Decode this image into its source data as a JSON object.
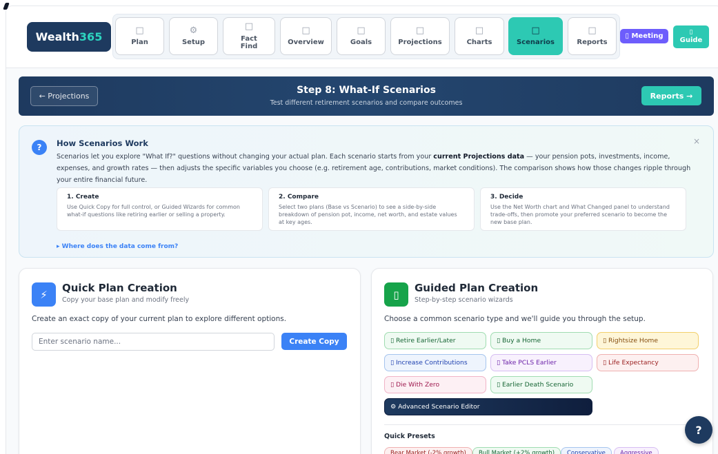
{
  "brand": {
    "name": "Wealth",
    "num": "365"
  },
  "nav": [
    {
      "icon": "□",
      "label": "Plan"
    },
    {
      "icon": "⚙",
      "label": "Setup"
    },
    {
      "icon": "□",
      "label": "Fact\nFind"
    },
    {
      "icon": "□",
      "label": "Overview"
    },
    {
      "icon": "□",
      "label": "Goals"
    },
    {
      "icon": "□",
      "label": "Projections"
    },
    {
      "icon": "□",
      "label": "Charts"
    },
    {
      "icon": "□",
      "label": "Scenarios"
    },
    {
      "icon": "□",
      "label": "Reports"
    }
  ],
  "header_actions": {
    "meeting": "▯ Meeting",
    "guide_icon": "▯",
    "guide": "Guide"
  },
  "step": {
    "back_label": "← Projections",
    "title": "Step 8: What-If Scenarios",
    "subtitle": "Test different retirement scenarios and compare outcomes",
    "next_label": "Reports →"
  },
  "info": {
    "icon": "?",
    "close": "×",
    "title": "How Scenarios Work",
    "text_pre": "Scenarios let you explore \"What If?\" questions without changing your actual plan. Each scenario starts from your ",
    "text_bold": "current Projections data",
    "text_post": " — your pension pots, investments, income, expenses, and growth rates — then adjusts the specific variables you choose (e.g. retirement age, contributions, market conditions). The comparison shows how those changes ripple through your entire financial future.",
    "cards": [
      {
        "title": "1. Create",
        "desc": "Use Quick Copy for full control, or Guided Wizards for common what-if questions like retiring earlier or selling a property."
      },
      {
        "title": "2. Compare",
        "desc": "Select two plans (Base vs Scenario) to see a side-by-side breakdown of pension pot, income, net worth, and estate values at key ages."
      },
      {
        "title": "3. Decide",
        "desc": "Use the Net Worth chart and What Changed panel to understand trade-offs, then promote your preferred scenario to become the new base plan."
      }
    ],
    "data_link": "▸ Where does the data come from?"
  },
  "quick": {
    "icon": "⚡",
    "title": "Quick Plan Creation",
    "subtitle": "Copy your base plan and modify freely",
    "desc": "Create an exact copy of your current plan to explore different options.",
    "input_placeholder": "Enter scenario name...",
    "input_value": "",
    "button": "Create Copy"
  },
  "guided": {
    "icon": "▯",
    "title": "Guided Plan Creation",
    "subtitle": "Step-by-step scenario wizards",
    "desc": "Choose a common scenario type and we'll guide you through the setup.",
    "chips": [
      "▯ Retire Earlier/Later",
      "▯ Buy a Home",
      "▯ Rightsize Home",
      "▯ Increase Contributions",
      "▯ Take PCLS Earlier",
      "▯ Life Expectancy",
      "▯ Die With Zero",
      "▯ Earlier Death Scenario",
      "⚙ Advanced Scenario Editor"
    ],
    "presets_title": "Quick Presets",
    "presets": [
      "Bear Market (-2% growth)",
      "Bull Market (+2% growth)",
      "Conservative",
      "Aggressive"
    ]
  },
  "help_fab": "?",
  "colors": {
    "navy": "#1e3a5f",
    "teal": "#2dc9b3",
    "blue": "#3b82f6",
    "purple": "#6d5dfc"
  }
}
